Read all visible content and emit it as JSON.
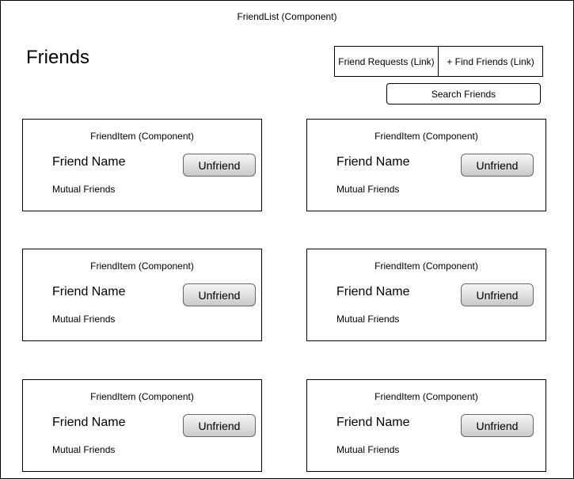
{
  "friend_list": {
    "component_label": "FriendList (Component)",
    "heading": "Friends",
    "links": {
      "friend_requests": "Friend Requests (Link)",
      "find_friends": "+ Find Friends (Link)"
    },
    "search": {
      "label": "Search Friends"
    }
  },
  "friend_items": [
    {
      "component_label": "FriendItem (Component)",
      "name": "Friend Name",
      "mutual": "Mutual Friends",
      "button": "Unfriend"
    },
    {
      "component_label": "FriendItem (Component)",
      "name": "Friend Name",
      "mutual": "Mutual Friends",
      "button": "Unfriend"
    },
    {
      "component_label": "FriendItem (Component)",
      "name": "Friend Name",
      "mutual": "Mutual Friends",
      "button": "Unfriend"
    },
    {
      "component_label": "FriendItem (Component)",
      "name": "Friend Name",
      "mutual": "Mutual Friends",
      "button": "Unfriend"
    },
    {
      "component_label": "FriendItem (Component)",
      "name": "Friend Name",
      "mutual": "Mutual Friends",
      "button": "Unfriend"
    },
    {
      "component_label": "FriendItem (Component)",
      "name": "Friend Name",
      "mutual": "Mutual Friends",
      "button": "Unfriend"
    }
  ]
}
